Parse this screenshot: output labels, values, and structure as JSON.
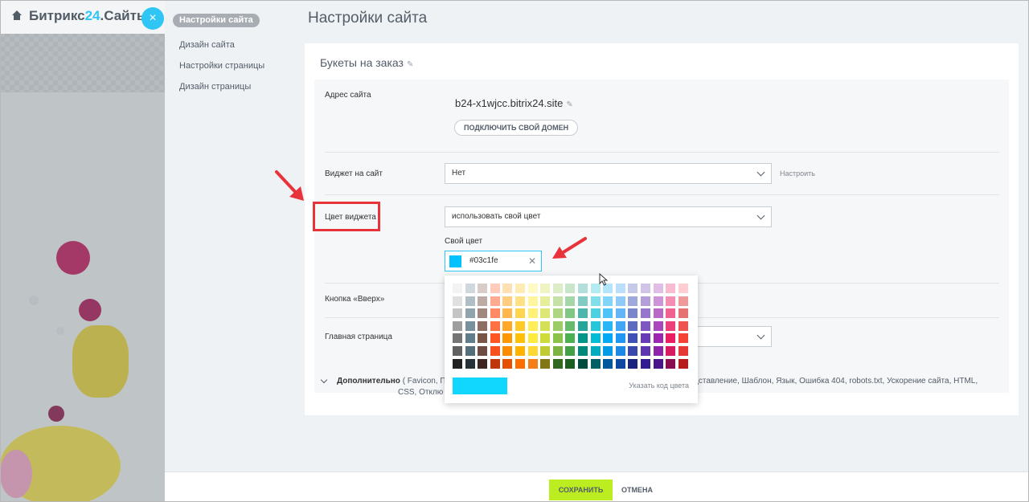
{
  "brand": {
    "name_main": "Битрикс",
    "name_accent": "24",
    "name_suffix": ".Сайты"
  },
  "close_label": "×",
  "nav": [
    {
      "label": "Настройки сайта",
      "active": true
    },
    {
      "label": "Дизайн сайта"
    },
    {
      "label": "Настройки страницы"
    },
    {
      "label": "Дизайн страницы"
    }
  ],
  "page_title": "Настройки сайта",
  "site_name": "Букеты на заказ",
  "form": {
    "address_label": "Адрес сайта",
    "domain": "b24-x1wjcc.bitrix24.site",
    "connect_domain": "ПОДКЛЮЧИТЬ СВОЙ ДОМЕН",
    "widget_label": "Виджет на сайт",
    "widget_value": "Нет",
    "widget_configure": "Настроить",
    "widget_color_label": "Цвет виджета",
    "widget_color_value": "использовать свой цвет",
    "own_color_label": "Свой цвет",
    "own_color_value": "#03c1fe",
    "up_button_label": "Кнопка «Вверх»",
    "main_page_label": "Главная страница"
  },
  "extra": {
    "title": "Дополнительно",
    "line1_start": "( Favicon,  По",
    "line1_end": "редставление,  Шаблон,  Язык,  Ошибка 404,  robots.txt,  Ускорение сайта,  HTML,",
    "line2": "CSS,  Отклю"
  },
  "palette": {
    "specify_code": "Указать код цвета",
    "current_color": "#11d7ff",
    "columns": [
      [
        "#f3f3f3",
        "#e0e0e0",
        "#c5c5c5",
        "#9e9e9e",
        "#757575",
        "#616161",
        "#212121"
      ],
      [
        "#cfd8dc",
        "#b0bec5",
        "#90a4ae",
        "#78909c",
        "#607d8b",
        "#546e7a",
        "#263238"
      ],
      [
        "#d7ccc8",
        "#bcaaa4",
        "#a1887f",
        "#8d6e63",
        "#795548",
        "#6d4c41",
        "#3e2723"
      ],
      [
        "#ffccbc",
        "#ffab91",
        "#ff8a65",
        "#ff7043",
        "#ff5722",
        "#f4511e",
        "#bf360c"
      ],
      [
        "#ffe0b2",
        "#ffcc80",
        "#ffb74d",
        "#ffa726",
        "#ff9800",
        "#fb8c00",
        "#e65100"
      ],
      [
        "#ffecb3",
        "#ffe082",
        "#ffd54f",
        "#ffca28",
        "#ffc107",
        "#ffb300",
        "#ff6f00"
      ],
      [
        "#fff9c4",
        "#fff59d",
        "#fff176",
        "#ffee58",
        "#ffeb3b",
        "#fdd835",
        "#f57f17"
      ],
      [
        "#f0f4c3",
        "#e6ee9c",
        "#dce775",
        "#d4e157",
        "#cddc39",
        "#c0ca33",
        "#827717"
      ],
      [
        "#dcedc8",
        "#c5e1a5",
        "#aed581",
        "#9ccc65",
        "#8bc34a",
        "#7cb342",
        "#33691e"
      ],
      [
        "#c8e6c9",
        "#a5d6a7",
        "#81c784",
        "#66bb6a",
        "#4caf50",
        "#43a047",
        "#1b5e20"
      ],
      [
        "#b2dfdb",
        "#80cbc4",
        "#4db6ac",
        "#26a69a",
        "#009688",
        "#00897b",
        "#004d40"
      ],
      [
        "#b2ebf2",
        "#80deea",
        "#4dd0e1",
        "#26c6da",
        "#00bcd4",
        "#00acc1",
        "#006064"
      ],
      [
        "#b3e5fc",
        "#81d4fa",
        "#4fc3f7",
        "#29b6f6",
        "#03a9f4",
        "#039be5",
        "#01579b"
      ],
      [
        "#bbdefb",
        "#90caf9",
        "#64b5f6",
        "#42a5f5",
        "#2196f3",
        "#1e88e5",
        "#0d47a1"
      ],
      [
        "#c5cae9",
        "#9fa8da",
        "#7986cb",
        "#5c6bc0",
        "#3f51b5",
        "#3949ab",
        "#1a237e"
      ],
      [
        "#d1c4e9",
        "#b39ddb",
        "#9575cd",
        "#7e57c2",
        "#673ab7",
        "#5e35b1",
        "#311b92"
      ],
      [
        "#e1bee7",
        "#ce93d8",
        "#ba68c8",
        "#ab47bc",
        "#9c27b0",
        "#8e24aa",
        "#4a148c"
      ],
      [
        "#f8bbd0",
        "#f48fb1",
        "#f06292",
        "#ec407a",
        "#e91e63",
        "#d81b60",
        "#880e4f"
      ],
      [
        "#ffcdd2",
        "#ef9a9a",
        "#e57373",
        "#ef5350",
        "#f44336",
        "#e53935",
        "#b71c1c"
      ]
    ]
  },
  "footer": {
    "save": "СОХРАНИТЬ",
    "cancel": "ОТМЕНА"
  }
}
